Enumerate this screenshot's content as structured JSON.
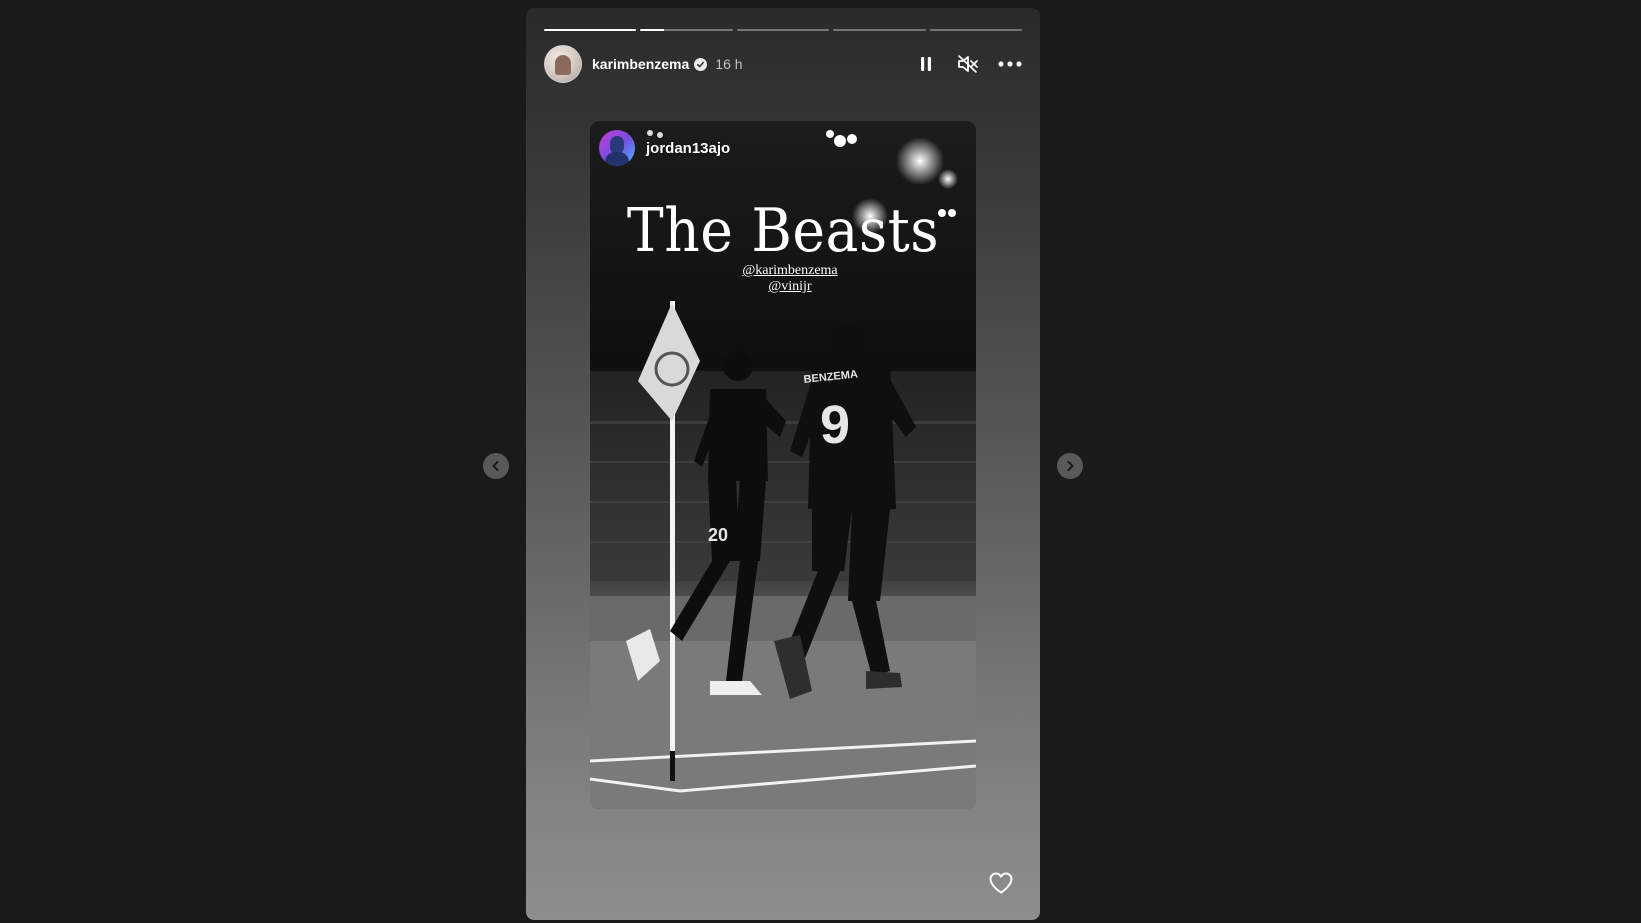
{
  "story": {
    "username": "karimbenzema",
    "verified": true,
    "time": "16 h",
    "progress_segments": [
      1,
      0.25,
      0,
      0,
      0
    ],
    "controls": {
      "pause_icon": "pause-icon",
      "mute_icon": "speaker-muted-icon",
      "more_icon": "more-horizontal-icon"
    }
  },
  "media": {
    "mention_username": "jordan13ajo",
    "headline": "The Beasts",
    "tags": [
      "@karimbenzema",
      "@vinijr"
    ],
    "jersey_numbers": [
      "9",
      "20"
    ],
    "jersey_name": "BENZEMA"
  },
  "navigation": {
    "prev_icon": "chevron-left-icon",
    "next_icon": "chevron-right-icon"
  },
  "actions": {
    "like_icon": "heart-outline-icon"
  }
}
